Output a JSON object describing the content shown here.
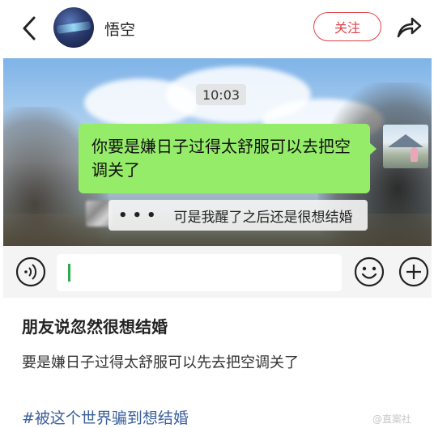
{
  "header": {
    "username": "悟空",
    "follow_label": "关注",
    "back_icon": "chevron-left-icon",
    "share_icon": "share-icon"
  },
  "chat": {
    "timestamp": "10:03",
    "sent_message": "你要是嫌日子过得太舒服可以去把空调关了",
    "reply_sender": "•••",
    "reply_message": "可是我醒了之后还是很想结婚",
    "sent_bubble_color": "#95ec69"
  },
  "input_bar": {
    "voice_icon": "voice-icon",
    "emoji_icon": "emoji-icon",
    "plus_icon": "plus-icon",
    "caret_color": "#2ea84a"
  },
  "post": {
    "title": "朋友说忽然很想结婚",
    "body": "要是嫌日子过得太舒服可以先去把空调关了",
    "hashtag": "#被这个世界骗到想结婚",
    "watermark": "@直案社",
    "follow_color": "#e0424a",
    "hashtag_color": "#3a5f9e"
  }
}
